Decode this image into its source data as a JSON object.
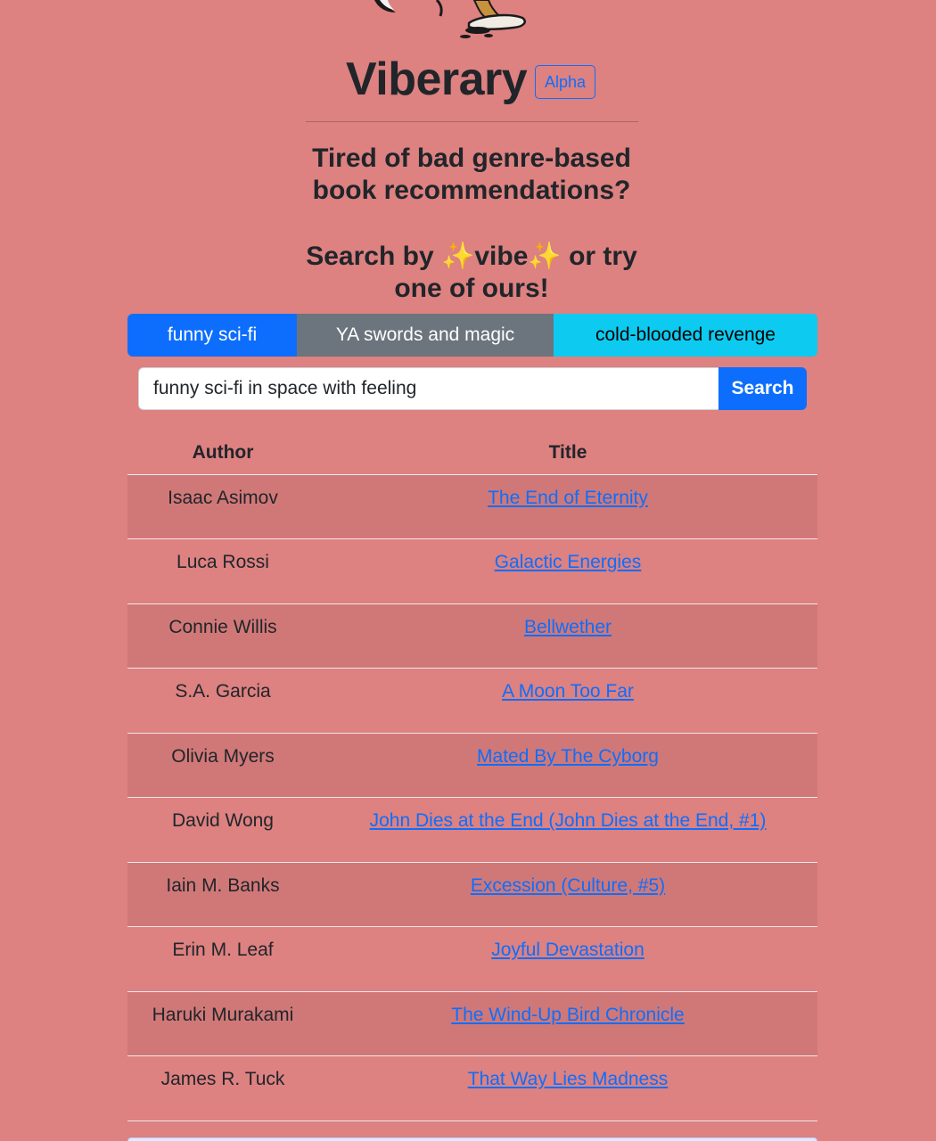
{
  "header": {
    "title": "Viberary",
    "badge": "Alpha"
  },
  "tagline": {
    "line1": "Tired of bad genre-based book recommendations?",
    "line2_before": "Search by ",
    "line2_sparkle": "✨",
    "line2_vibe": "vibe",
    "line2_after": " or try one of ours!"
  },
  "examples": [
    "funny sci-fi",
    "YA swords and magic",
    "cold-blooded revenge"
  ],
  "search": {
    "value": "funny sci-fi in space with feeling",
    "button_label": "Search"
  },
  "results": {
    "headers": {
      "author": "Author",
      "title": "Title"
    },
    "rows": [
      {
        "author": "Isaac Asimov",
        "title": "The End of Eternity"
      },
      {
        "author": "Luca Rossi",
        "title": "Galactic Energies"
      },
      {
        "author": "Connie Willis",
        "title": "Bellwether"
      },
      {
        "author": "S.A. Garcia",
        "title": "A Moon Too Far"
      },
      {
        "author": "Olivia Myers",
        "title": "Mated By The Cyborg"
      },
      {
        "author": "David Wong",
        "title": "John Dies at the End (John Dies at the End, #1)"
      },
      {
        "author": "Iain M. Banks",
        "title": "Excession (Culture, #5)"
      },
      {
        "author": "Erin M. Leaf",
        "title": "Joyful Devastation"
      },
      {
        "author": "Haruki Murakami",
        "title": "The Wind-Up Bird Chronicle"
      },
      {
        "author": "James R. Tuck",
        "title": "That Way Lies Madness"
      }
    ]
  },
  "colors": {
    "background": "#dd8181",
    "primary": "#0d6efd",
    "secondary": "#6c757d",
    "info": "#0dcaf0"
  }
}
